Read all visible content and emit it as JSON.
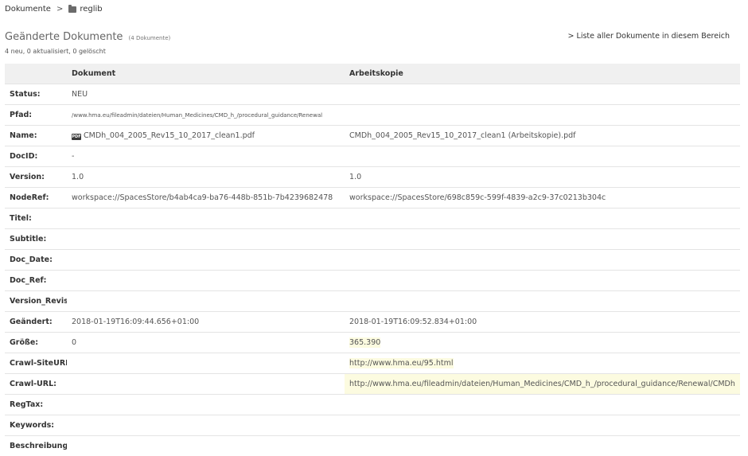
{
  "breadcrumb": {
    "root": "Dokumente",
    "separator": ">",
    "folder": "reglib",
    "folder_icon": "folder-icon"
  },
  "header": {
    "title": "Geänderte Dokumente",
    "count": "(4 Dokumente)",
    "list_link": "> Liste aller Dokumente in diesem Bereich",
    "summary": "4 neu, 0 aktualisiert, 0 gelöscht"
  },
  "table": {
    "columns": {
      "label": "",
      "document": "Dokument",
      "working_copy": "Arbeitskopie"
    },
    "rows": {
      "status": {
        "label": "Status:",
        "doc": "NEU",
        "copy": ""
      },
      "pfad": {
        "label": "Pfad:",
        "doc": "/www.hma.eu/fileadmin/dateien/Human_Medicines/CMD_h_/procedural_guidance/Renewal",
        "copy": ""
      },
      "name": {
        "label": "Name:",
        "doc_icon": "pdf-icon",
        "doc_icon_text": "PDF",
        "doc": "CMDh_004_2005_Rev15_10_2017_clean1.pdf",
        "copy": "CMDh_004_2005_Rev15_10_2017_clean1 (Arbeitskopie).pdf"
      },
      "docid": {
        "label": "DocID:",
        "doc": "-",
        "copy": ""
      },
      "version": {
        "label": "Version:",
        "doc": "1.0",
        "copy": "1.0"
      },
      "noderef": {
        "label": "NodeRef:",
        "doc": "workspace://SpacesStore/b4ab4ca9-ba76-448b-851b-7b4239682478",
        "copy": "workspace://SpacesStore/698c859c-599f-4839-a2c9-37c0213b304c"
      },
      "titel": {
        "label": "Titel:",
        "doc": "",
        "copy": ""
      },
      "subtitle": {
        "label": "Subtitle:",
        "doc": "",
        "copy": ""
      },
      "doc_date": {
        "label": "Doc_Date:",
        "doc": "",
        "copy": ""
      },
      "doc_ref": {
        "label": "Doc_Ref:",
        "doc": "",
        "copy": ""
      },
      "version_revision": {
        "label": "Version_Revision:",
        "doc": "",
        "copy": ""
      },
      "geaendert": {
        "label": "Geändert:",
        "doc": "2018-01-19T16:09:44.656+01:00",
        "copy": "2018-01-19T16:09:52.834+01:00"
      },
      "groesse": {
        "label": "Größe:",
        "doc": "0",
        "copy": "365.390"
      },
      "crawl_siteurl": {
        "label": "Crawl-SiteURL:",
        "doc": "",
        "copy": "http://www.hma.eu/95.html"
      },
      "crawl_url": {
        "label": "Crawl-URL:",
        "doc": "",
        "copy": "http://www.hma.eu/fileadmin/dateien/Human_Medicines/CMD_h_/procedural_guidance/Renewal/CMDh"
      },
      "regtax": {
        "label": "RegTax:",
        "doc": "",
        "copy": ""
      },
      "keywords": {
        "label": "Keywords:",
        "doc": "",
        "copy": ""
      },
      "beschreibung": {
        "label": "Beschreibung:",
        "doc": "",
        "copy": ""
      }
    }
  },
  "colors": {
    "highlight": "#fcfbe0",
    "header_bg": "#f0f0f0",
    "row_border": "#e4e4e4"
  }
}
